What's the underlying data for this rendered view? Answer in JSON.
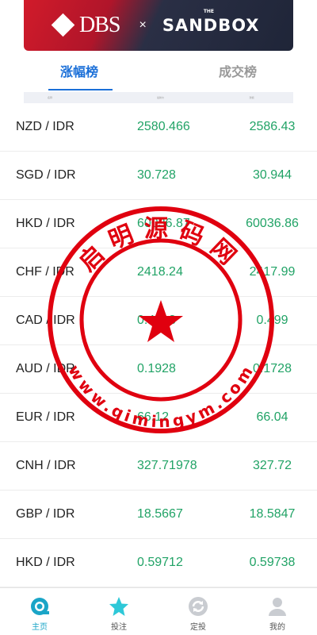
{
  "banner": {
    "dbs_text": "DBS",
    "cross": "×",
    "sandbox_the": "THE",
    "sandbox_text": "SANDBOX"
  },
  "tabs": [
    {
      "label": "涨幅榜",
      "active": true
    },
    {
      "label": "成交榜",
      "active": false
    }
  ],
  "list_header": {
    "name": "名称",
    "col1": "最新价",
    "col2": "涨幅"
  },
  "rows": [
    {
      "pair": "NZD / IDR",
      "v1": "2580.466",
      "v2": "2586.43"
    },
    {
      "pair": "SGD / IDR",
      "v1": "30.728",
      "v2": "30.944"
    },
    {
      "pair": "HKD / IDR",
      "v1": "60036.87",
      "v2": "60036.86"
    },
    {
      "pair": "CHF / IDR",
      "v1": "2418.24",
      "v2": "2417.99"
    },
    {
      "pair": "CAD / IDR",
      "v1": "0.4613",
      "v2": "0.499"
    },
    {
      "pair": "AUD / IDR",
      "v1": "0.1928",
      "v2": "0.1728"
    },
    {
      "pair": "EUR / IDR",
      "v1": "66.12",
      "v2": "66.04"
    },
    {
      "pair": "CNH / IDR",
      "v1": "327.71978",
      "v2": "327.72"
    },
    {
      "pair": "GBP / IDR",
      "v1": "18.5667",
      "v2": "18.5847"
    },
    {
      "pair": "HKD / IDR",
      "v1": "0.59712",
      "v2": "0.59738"
    }
  ],
  "watermark": {
    "top_text": "启明源码网",
    "bottom_text": "www.qimingym.com",
    "color": "#e0000f"
  },
  "nav": [
    {
      "label": "主页",
      "icon": "home-icon",
      "active": true
    },
    {
      "label": "投注",
      "icon": "star-icon",
      "active": false
    },
    {
      "label": "定投",
      "icon": "refresh-icon",
      "active": false
    },
    {
      "label": "我的",
      "icon": "user-icon",
      "active": false
    }
  ],
  "colors": {
    "accent": "#1a6fd8",
    "positive": "#21a366",
    "nav_active": "#1aa5c7"
  }
}
